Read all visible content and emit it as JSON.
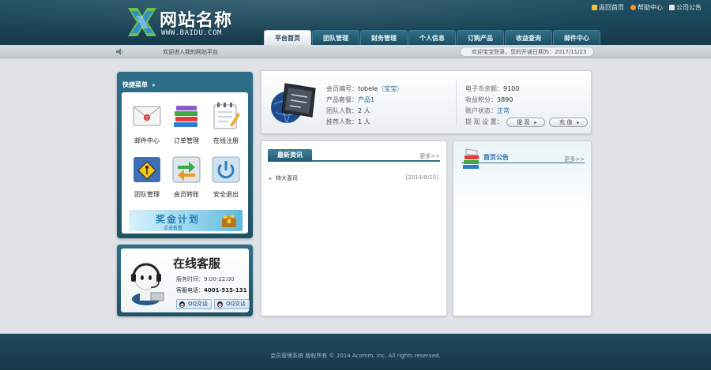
{
  "header": {
    "site_name": "网站名称",
    "site_url": "WWW.BAIDU.COM",
    "top_links": [
      {
        "label": "返回首页",
        "icon": "speaker-icon"
      },
      {
        "label": "帮助中心",
        "icon": "help-icon"
      },
      {
        "label": "公司公告",
        "icon": "home-icon"
      }
    ],
    "nav": [
      {
        "label": "平台首页",
        "active": true
      },
      {
        "label": "团队管理"
      },
      {
        "label": "财务管理"
      },
      {
        "label": "个人信息"
      },
      {
        "label": "订购产品"
      },
      {
        "label": "收益查询"
      },
      {
        "label": "邮件中心"
      }
    ]
  },
  "info_bar": {
    "welcome": "欢迎进入我的网站平台",
    "user_status": "欢迎宝宝登录，您的开通日期为：2017/11/23"
  },
  "quick_menu": {
    "title": "快捷菜单",
    "items": [
      {
        "label": "邮件中心",
        "icon": "mail-icon"
      },
      {
        "label": "订单管理",
        "icon": "books-icon"
      },
      {
        "label": "在线注册",
        "icon": "notepad-icon"
      },
      {
        "label": "团队管理",
        "icon": "warning-sign-icon"
      },
      {
        "label": "会员转账",
        "icon": "transfer-icon"
      },
      {
        "label": "安全退出",
        "icon": "power-icon"
      }
    ],
    "banner": {
      "title": "奖金计划",
      "subtitle": "点击查看"
    }
  },
  "service": {
    "title": "在线客服",
    "hours": "服务时间：9:00-22:00",
    "phone_label": "客服电话：",
    "phone": "4001-515-131",
    "qq_buttons": [
      "QQ交谈",
      "QQ交谈"
    ]
  },
  "account": {
    "left": [
      {
        "label": "会员编号：",
        "value": "tobele",
        "link": "（宝宝）"
      },
      {
        "label": "产品套餐：",
        "value": "产品1"
      },
      {
        "label": "团队人数：",
        "value": "2 人"
      },
      {
        "label": "推荐人数：",
        "value": "1 人"
      }
    ],
    "right": [
      {
        "label": "电子币余额：",
        "value": "9100"
      },
      {
        "label": "收益积分：",
        "value": "3890"
      },
      {
        "label": "账户状态：",
        "value": "正常"
      },
      {
        "label": "提 现 设 置："
      }
    ],
    "buttons": [
      "提 现",
      "充 值"
    ]
  },
  "news": {
    "tab": "最新资讯",
    "more": "更多>>",
    "items": [
      {
        "title": "特大喜讯",
        "date": "[2014/8/10]"
      }
    ]
  },
  "notice": {
    "title": "首页公告",
    "more": "更多>>"
  },
  "footer": {
    "text": "会员管理系统   版权所有   © 2014 Acomm, Inc. All rights reserved."
  }
}
